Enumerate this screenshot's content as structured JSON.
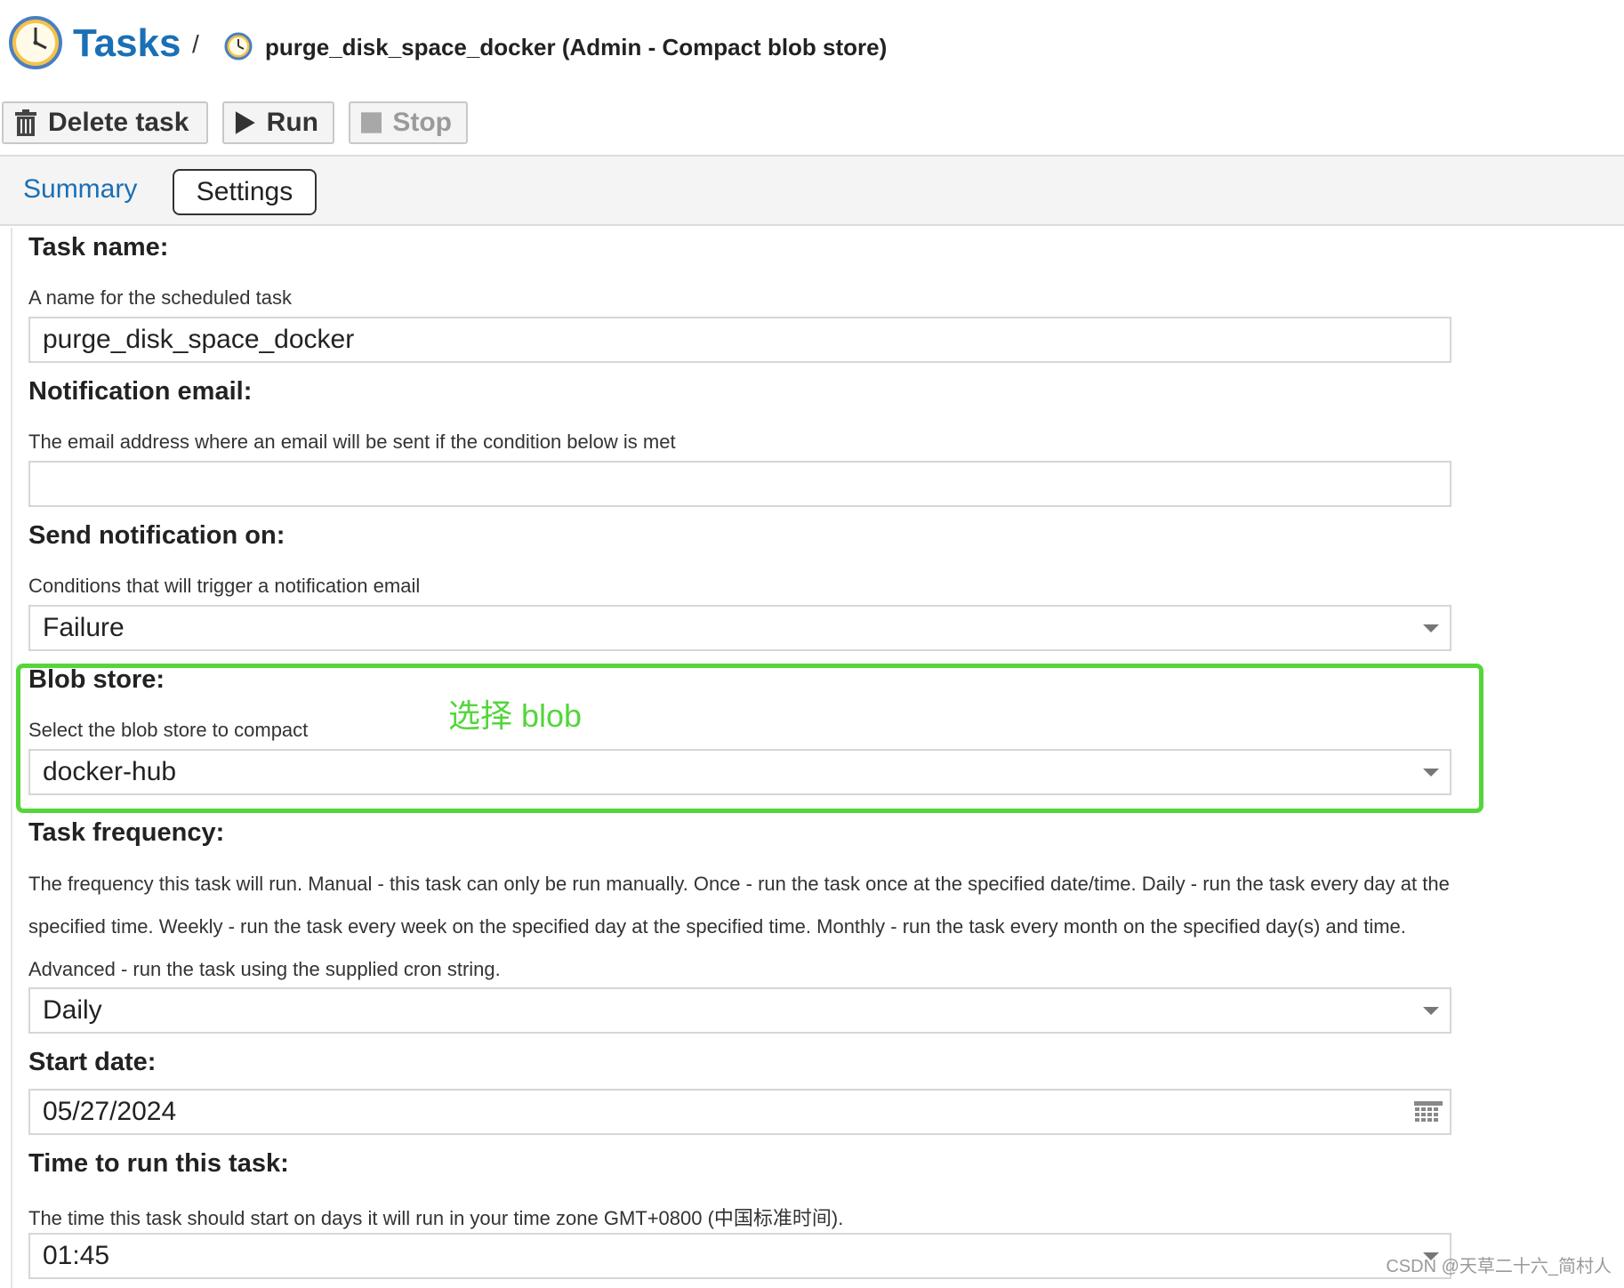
{
  "header": {
    "app_title": "Tasks",
    "separator": "/",
    "task_title": "purge_disk_space_docker (Admin - Compact blob store)"
  },
  "toolbar": {
    "delete_label": "Delete task",
    "run_label": "Run",
    "stop_label": "Stop"
  },
  "tabs": [
    {
      "label": "Summary"
    },
    {
      "label": "Settings"
    }
  ],
  "form": {
    "task_name": {
      "label": "Task name:",
      "help": "A name for the scheduled task",
      "value": "purge_disk_space_docker"
    },
    "notification_email": {
      "label": "Notification email:",
      "help": "The email address where an email will be sent if the condition below is met",
      "value": ""
    },
    "send_notification": {
      "label": "Send notification on:",
      "help": "Conditions that will trigger a notification email",
      "value": "Failure"
    },
    "blob_store": {
      "label": "Blob store:",
      "help": "Select the blob store to compact",
      "value": "docker-hub"
    },
    "task_frequency": {
      "label": "Task frequency:",
      "help": "The frequency this task will run. Manual - this task can only be run manually. Once - run the task once at the specified date/time. Daily - run the task every day at the specified time. Weekly - run the task every week on the specified day at the specified time. Monthly - run the task every month on the specified day(s) and time. Advanced - run the task using the supplied cron string.",
      "value": "Daily"
    },
    "start_date": {
      "label": "Start date:",
      "value": "05/27/2024"
    },
    "time_to_run": {
      "label": "Time to run this task:",
      "help": "The time this task should start on days it will run in your time zone GMT+0800 (中国标准时间).",
      "value": "01:45"
    }
  },
  "annotation": {
    "text": "选择 blob",
    "color": "#53d63a"
  },
  "watermark": "CSDN @天草二十六_简村人",
  "colors": {
    "link_blue": "#1a6fb5",
    "highlight_green": "#53d63a"
  }
}
